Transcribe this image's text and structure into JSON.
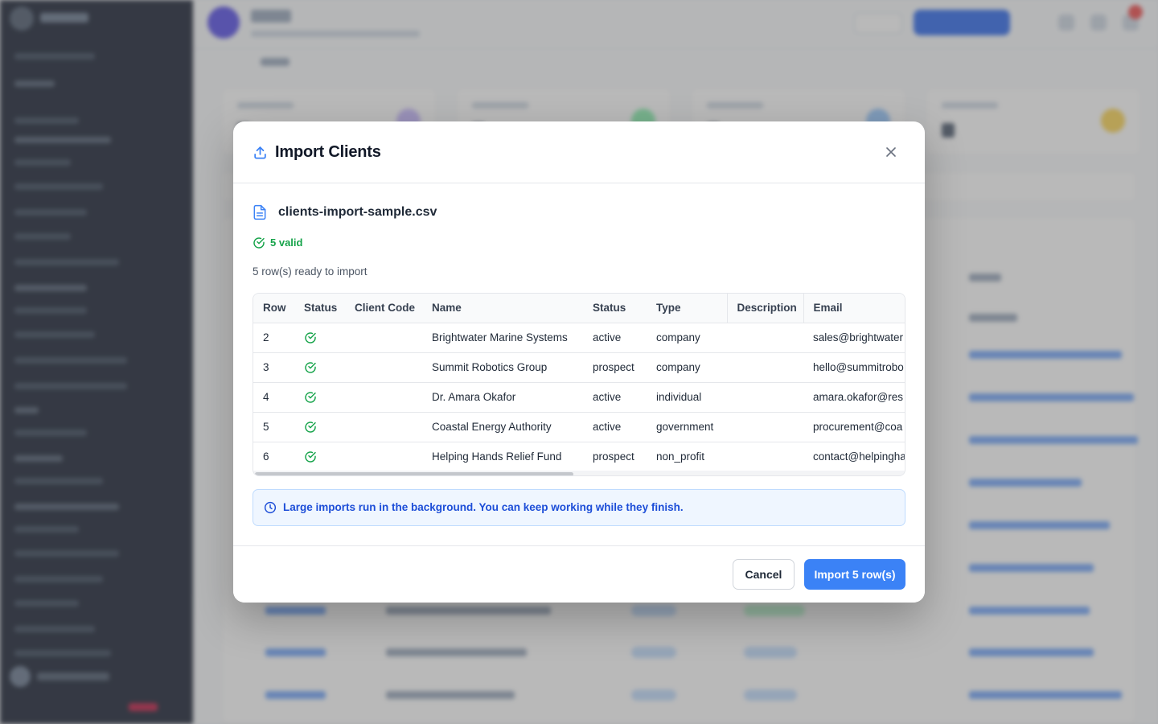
{
  "modal": {
    "title": "Import Clients",
    "file_name": "clients-import-sample.csv",
    "valid_label": "5 valid",
    "ready_text": "5 row(s) ready to import",
    "columns": [
      "Row",
      "Status",
      "Client Code",
      "Name",
      "Status",
      "Type",
      "Description",
      "Email"
    ],
    "rows": [
      {
        "row": "2",
        "status_icon": "check-circle-icon",
        "client_code": "",
        "name": "Brightwater Marine Systems",
        "status": "active",
        "type": "company",
        "description": "",
        "email": "sales@brightwater"
      },
      {
        "row": "3",
        "status_icon": "check-circle-icon",
        "client_code": "",
        "name": "Summit Robotics Group",
        "status": "prospect",
        "type": "company",
        "description": "",
        "email": "hello@summitrobo"
      },
      {
        "row": "4",
        "status_icon": "check-circle-icon",
        "client_code": "",
        "name": "Dr. Amara Okafor",
        "status": "active",
        "type": "individual",
        "description": "",
        "email": "amara.okafor@res"
      },
      {
        "row": "5",
        "status_icon": "check-circle-icon",
        "client_code": "",
        "name": "Coastal Energy Authority",
        "status": "active",
        "type": "government",
        "description": "",
        "email": "procurement@coa"
      },
      {
        "row": "6",
        "status_icon": "check-circle-icon",
        "client_code": "",
        "name": "Helping Hands Relief Fund",
        "status": "prospect",
        "type": "non_profit",
        "description": "",
        "email": "contact@helpingha"
      }
    ],
    "info_text": "Large imports run in the background. You can keep working while they finish.",
    "cancel_label": "Cancel",
    "import_label": "Import 5 row(s)"
  },
  "colors": {
    "accent": "#3b82f6",
    "success": "#16a34a",
    "info_text": "#1d4ed8",
    "info_bg": "#eff6ff",
    "sidebar_bg": "#0f172a"
  }
}
